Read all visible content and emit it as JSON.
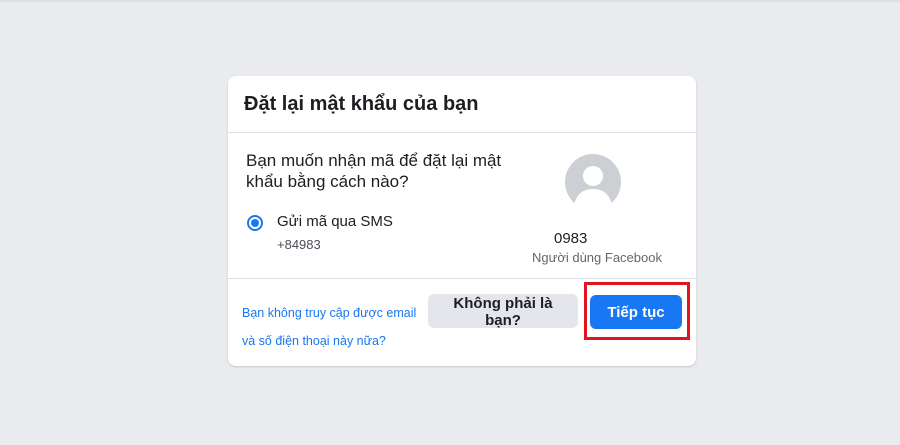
{
  "dialog": {
    "title": "Đặt lại mật khẩu của bạn",
    "question": "Bạn muốn nhận mã để đặt lại mật khẩu bằng cách nào?"
  },
  "option": {
    "label": "Gửi mã qua SMS",
    "phone": "+84983",
    "selected": true
  },
  "account": {
    "number": "0983",
    "type": "Người dùng Facebook",
    "avatar_icon": "default-user-avatar-icon"
  },
  "footer": {
    "help_link": "Bạn không truy cập được email và số điện thoại này nữa?",
    "not_you_label": "Không phải là bạn?",
    "continue_label": "Tiếp tục"
  },
  "colors": {
    "accent": "#1877f2",
    "highlight_border": "#e0151f",
    "background": "#e9ebee"
  }
}
